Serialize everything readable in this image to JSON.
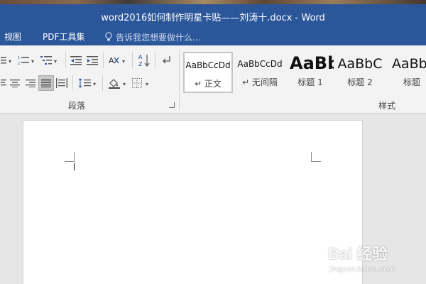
{
  "window": {
    "title": "word2016如何制作明星卡贴——刘涛十.docx - Word"
  },
  "tabs": [
    {
      "label": "视图"
    },
    {
      "label": "PDF工具集"
    }
  ],
  "tell_me": {
    "placeholder": "告诉我您想要做什么..."
  },
  "ribbon": {
    "paragraph_group_label": "段落",
    "styles_group_label": "样式",
    "styles": [
      {
        "sample": "AaBbCcDd",
        "name": "↵ 正文",
        "selected": true
      },
      {
        "sample": "AaBbCcDd",
        "name": "↵ 无间隔",
        "selected": false
      },
      {
        "sample": "AaBb",
        "name": "标题 1",
        "selected": false
      },
      {
        "sample": "AaBbC",
        "name": "标题 2",
        "selected": false
      },
      {
        "sample": "AaBb",
        "name": "标题",
        "selected": false
      }
    ]
  },
  "watermark": {
    "text": "Bai 经验",
    "url": "jingyan.baidu.com"
  }
}
